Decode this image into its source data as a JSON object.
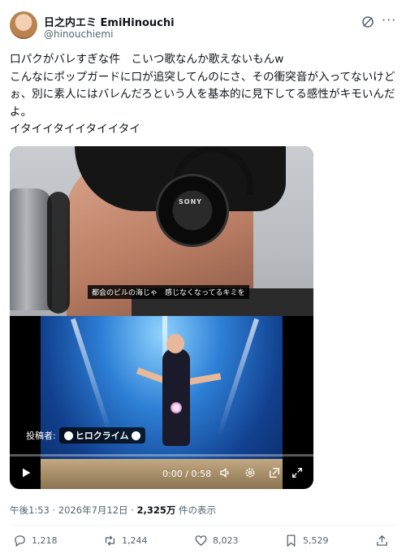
{
  "author": {
    "name": "日之内エミ EmiHinouchi",
    "handle": "@hinouchiemi"
  },
  "icons": {
    "grok": "grok-icon",
    "more": "more-options-icon"
  },
  "tweet": {
    "text": "口パクがバレすぎな件　こいつ歌なんか歌えないもんw\nこんなにポップガードに口が追突してんのにさ、その衝突音が入ってないけどぉ、別に素人にはバレんだろという人を基本的に見下してる感性がキモいんだよ。\nイタイイタイイタイイタイ"
  },
  "video": {
    "subtitle": "都会のビルの海じゃ　感じなくなってるキミを",
    "headphone_brand": "SONY",
    "credit_prefix": "投稿者:",
    "credit_name": "ヒロクライム",
    "time": "0:00 / 0:58",
    "progress_fraction": 0
  },
  "meta": {
    "time": "午後1:53",
    "sep1": "·",
    "date": "2026年7月12日",
    "sep2": "·",
    "views_count": "2,325万",
    "views_label": "件の表示"
  },
  "actions": {
    "replies": "1,218",
    "reposts": "1,244",
    "likes": "8,023",
    "bookmarks": "5,529"
  },
  "colors": {
    "text": "#0f1419",
    "secondary": "#536471",
    "divider": "#eff3f4"
  }
}
